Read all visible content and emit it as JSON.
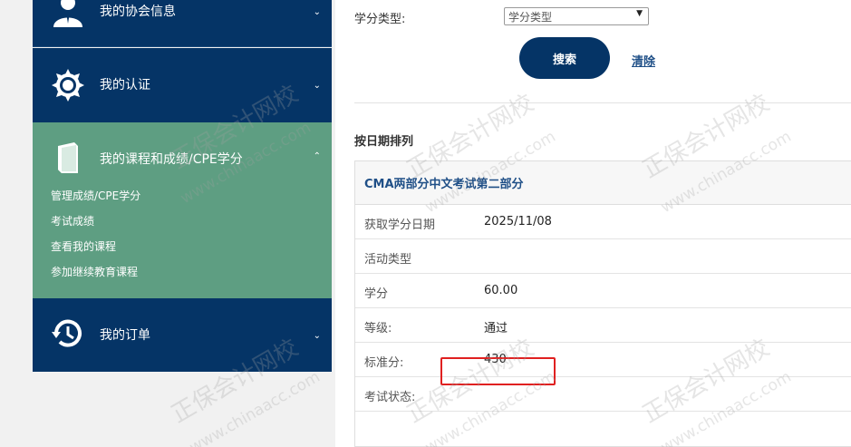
{
  "sidebar": {
    "items": [
      {
        "label": "我的协会信息",
        "icon": "user-icon"
      },
      {
        "label": "我的认证",
        "icon": "badge-icon"
      },
      {
        "label": "我的课程和成绩/CPE学分",
        "icon": "book-icon"
      },
      {
        "label": "我的订单",
        "icon": "history-icon"
      }
    ],
    "subitems": [
      "管理成绩/CPE学分",
      "考试成绩",
      "查看我的课程",
      "参加继续教育课程"
    ]
  },
  "filter": {
    "label": "学分类型:",
    "select_value": "学分类型",
    "search_button": "搜索",
    "clear_link": "清除"
  },
  "sort_title": "按日期排列",
  "record": {
    "title": "CMA两部分中文考试第二部分",
    "rows": [
      {
        "key": "获取学分日期",
        "value": "2025/11/08"
      },
      {
        "key": "活动类型",
        "value": ""
      },
      {
        "key": "学分",
        "value": "60.00"
      },
      {
        "key": "等级:",
        "value": "通过"
      },
      {
        "key": "标准分:",
        "value": "430"
      },
      {
        "key": "考试状态:",
        "value": ""
      }
    ]
  },
  "watermark": {
    "cn": "正保会计网校",
    "en": "www.chinaacc.com"
  },
  "colors": {
    "navy": "#053466",
    "green": "#5e9e82",
    "highlight": "#e02020"
  }
}
